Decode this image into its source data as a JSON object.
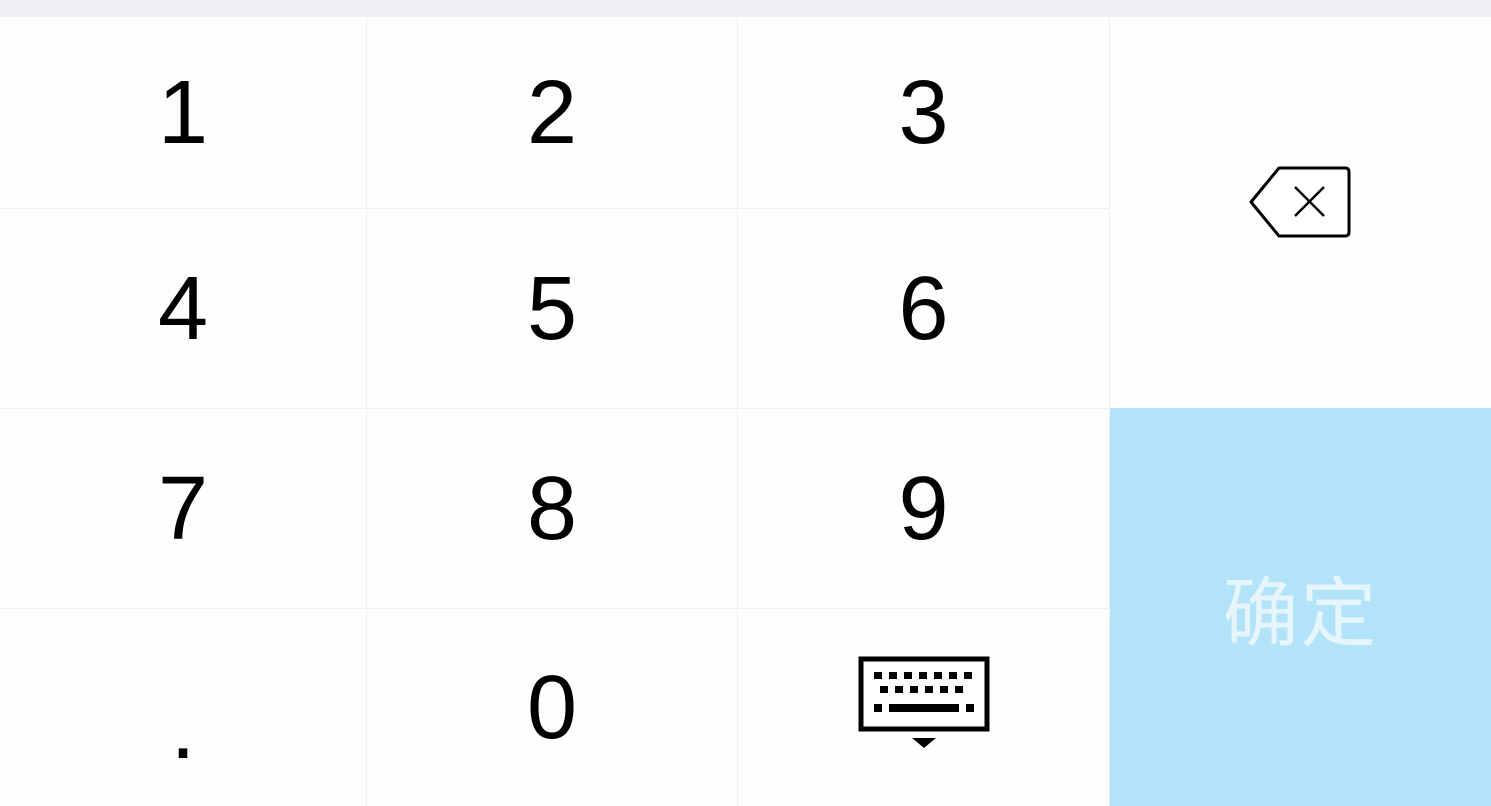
{
  "keypad": {
    "keys": {
      "k1": "1",
      "k2": "2",
      "k3": "3",
      "k4": "4",
      "k5": "5",
      "k6": "6",
      "k7": "7",
      "k8": "8",
      "k9": "9",
      "dot": ".",
      "k0": "0"
    },
    "delete_icon": "backspace-icon",
    "hide_keyboard_icon": "keyboard-hide-icon",
    "confirm_label": "确定",
    "colors": {
      "background": "#fefefe",
      "top_strip": "#efeff4",
      "divider": "#efefef",
      "confirm_bg": "#b2e3f8",
      "confirm_text": "#e6f5fc",
      "digit_text": "#000000"
    }
  }
}
